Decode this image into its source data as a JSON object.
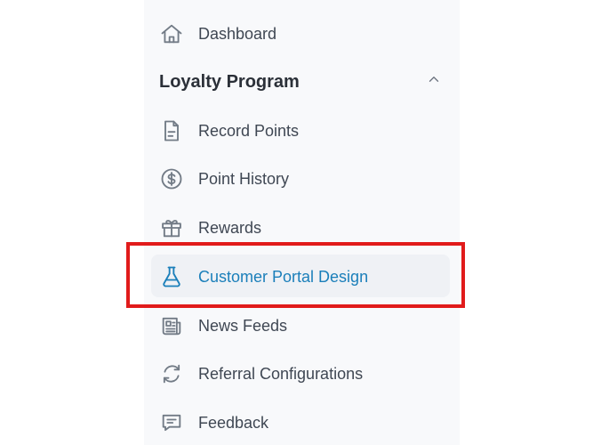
{
  "sidebar": {
    "dashboard": {
      "label": "Dashboard",
      "icon": "home-icon"
    },
    "section": {
      "title": "Loyalty Program",
      "chevron": "chevron-up-icon"
    },
    "items": [
      {
        "label": "Record Points",
        "icon": "document-icon"
      },
      {
        "label": "Point History",
        "icon": "dollar-circle-icon"
      },
      {
        "label": "Rewards",
        "icon": "gift-icon"
      },
      {
        "label": "Customer Portal Design",
        "icon": "flask-icon",
        "active": true
      },
      {
        "label": "News Feeds",
        "icon": "newspaper-icon"
      },
      {
        "label": "Referral Configurations",
        "icon": "refresh-icon"
      },
      {
        "label": "Feedback",
        "icon": "chat-bubble-icon"
      }
    ]
  },
  "colors": {
    "sidebar_bg": "#f8f9fb",
    "text": "#3f4753",
    "active_text": "#1b7fba",
    "active_bg": "#eff1f5",
    "highlight_border": "#e11b1b"
  }
}
